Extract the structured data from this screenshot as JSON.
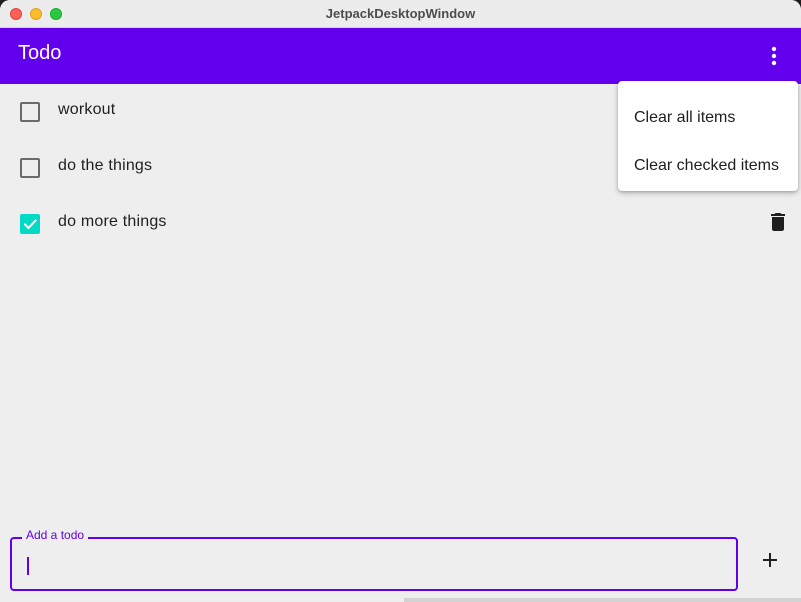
{
  "window": {
    "title": "JetpackDesktopWindow"
  },
  "appbar": {
    "title": "Todo",
    "color": "#6200ee",
    "overflow_icon": "more-vert-icon"
  },
  "todos": [
    {
      "text": "workout",
      "checked": false
    },
    {
      "text": "do the things",
      "checked": false
    },
    {
      "text": "do more things",
      "checked": true
    }
  ],
  "menu": {
    "items": [
      {
        "label": "Clear all items"
      },
      {
        "label": "Clear checked items"
      }
    ]
  },
  "input": {
    "label": "Add a todo",
    "value": "",
    "add_icon": "plus-icon"
  },
  "colors": {
    "primary": "#6200ee",
    "checked": "#03dac5",
    "background": "#eeeeee"
  }
}
